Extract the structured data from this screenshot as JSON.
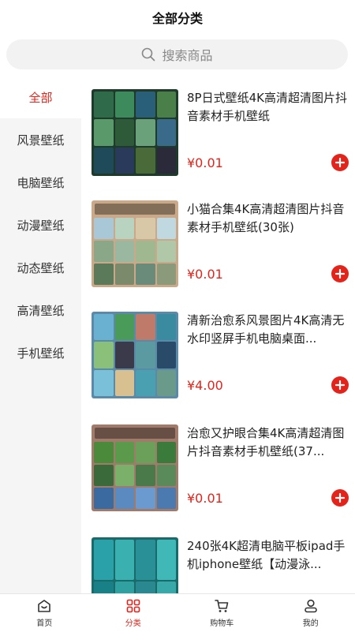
{
  "header": {
    "title": "全部分类"
  },
  "search": {
    "placeholder": "搜索商品",
    "icon": "search-icon"
  },
  "sidebar": {
    "items": [
      {
        "label": "全部",
        "active": true
      },
      {
        "label": "风景壁纸",
        "active": false
      },
      {
        "label": "电脑壁纸",
        "active": false
      },
      {
        "label": "动漫壁纸",
        "active": false
      },
      {
        "label": "动态壁纸",
        "active": false
      },
      {
        "label": "高清壁纸",
        "active": false
      },
      {
        "label": "手机壁纸",
        "active": false
      }
    ]
  },
  "products": [
    {
      "title": "8P日式壁纸4K高清超清图片抖音素材手机壁纸",
      "price": "¥0.01"
    },
    {
      "title": "小猫合集4K高清超清图片抖音素材手机壁纸(30张)",
      "price": "¥0.01"
    },
    {
      "title": "清新治愈系风景图片4K高清无水印竖屏手机电脑桌面...",
      "price": "¥4.00"
    },
    {
      "title": "治愈又护眼合集4K高清超清图片抖音素材手机壁纸(37...",
      "price": "¥0.01"
    },
    {
      "title": "240张4K超清电脑平板ipad手机iphone壁纸【动漫泳...",
      "price": ""
    }
  ],
  "tabbar": {
    "items": [
      {
        "label": "首页",
        "icon": "home-icon",
        "active": false
      },
      {
        "label": "分类",
        "icon": "grid-icon",
        "active": true
      },
      {
        "label": "购物车",
        "icon": "cart-icon",
        "active": false
      },
      {
        "label": "我的",
        "icon": "user-icon",
        "active": false
      }
    ]
  },
  "colors": {
    "accent": "#e4231a",
    "sidebar_bg": "#f5f5f5",
    "search_bg": "#f2f2f2"
  }
}
